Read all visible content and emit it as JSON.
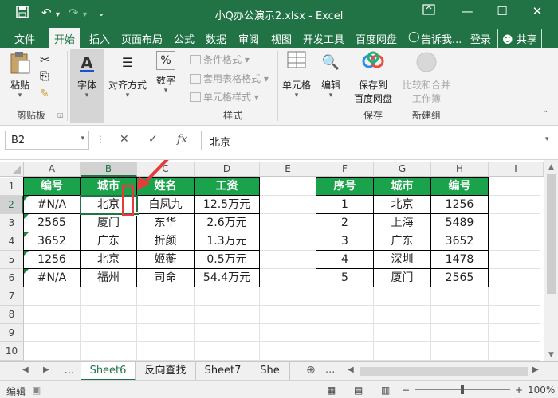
{
  "titlebar": {
    "title": "小Q办公演示2.xlsx - Excel",
    "save_icon": "save-icon",
    "undo_icon": "undo-icon",
    "redo_icon": "redo-icon",
    "customize_icon": "customize-icon",
    "ribbon_display_icon": "ribbon-display-icon",
    "minimize": "—",
    "maximize": "☐",
    "close": "✕"
  },
  "tabs": [
    "文件",
    "开始",
    "插入",
    "页面布局",
    "公式",
    "数据",
    "审阅",
    "视图",
    "开发工具",
    "百度网盘",
    "告诉我...",
    "登录",
    "共享"
  ],
  "ribbon": {
    "paste_label": "粘贴",
    "clipboard_label": "剪贴板",
    "font_label": "字体",
    "align_label": "对齐方式",
    "number_label": "数字",
    "cond_format": "条件格式",
    "table_format": "套用表格格式",
    "cell_style": "单元格样式",
    "style_label": "样式",
    "cells_label": "单元格",
    "edit_label": "编辑",
    "save_baidu_1": "保存到",
    "save_baidu_2": "百度网盘",
    "save_group_label": "保存",
    "merge_1": "比较和合并",
    "merge_2": "工作簿",
    "new_group_label": "新建组"
  },
  "formula_bar": {
    "name_box": "B2",
    "cancel": "✕",
    "enter": "✓",
    "fx": "fx",
    "value": "北京"
  },
  "columns": [
    "A",
    "B",
    "C",
    "D",
    "E",
    "F",
    "G",
    "H",
    "I"
  ],
  "rows": [
    "1",
    "2",
    "3",
    "4",
    "5",
    "6",
    "7",
    "8",
    "9",
    "10"
  ],
  "table1": {
    "headers": [
      "编号",
      "城市",
      "姓名",
      "工资"
    ],
    "rows": [
      [
        "#N/A",
        "北京",
        "白凤九",
        "12.5万元"
      ],
      [
        "2565",
        "厦门",
        "东华",
        "2.6万元"
      ],
      [
        "3652",
        "广东",
        "折颜",
        "1.3万元"
      ],
      [
        "1256",
        "北京",
        "姬蘅",
        "0.5万元"
      ],
      [
        "#N/A",
        "福州",
        "司命",
        "54.4万元"
      ]
    ]
  },
  "table2": {
    "headers": [
      "序号",
      "城市",
      "编号"
    ],
    "rows": [
      [
        "1",
        "北京",
        "1256"
      ],
      [
        "2",
        "上海",
        "5489"
      ],
      [
        "3",
        "广东",
        "3652"
      ],
      [
        "4",
        "深圳",
        "1478"
      ],
      [
        "5",
        "厦门",
        "2565"
      ]
    ]
  },
  "sheets": [
    "...",
    "Sheet6",
    "反向查找",
    "Sheet7",
    "She",
    "..."
  ],
  "status": {
    "mode": "编辑",
    "zoom": "100%"
  },
  "colors": {
    "excel_green": "#217346",
    "header_fill": "#1aa34a",
    "annotation_red": "#e63b3b"
  }
}
